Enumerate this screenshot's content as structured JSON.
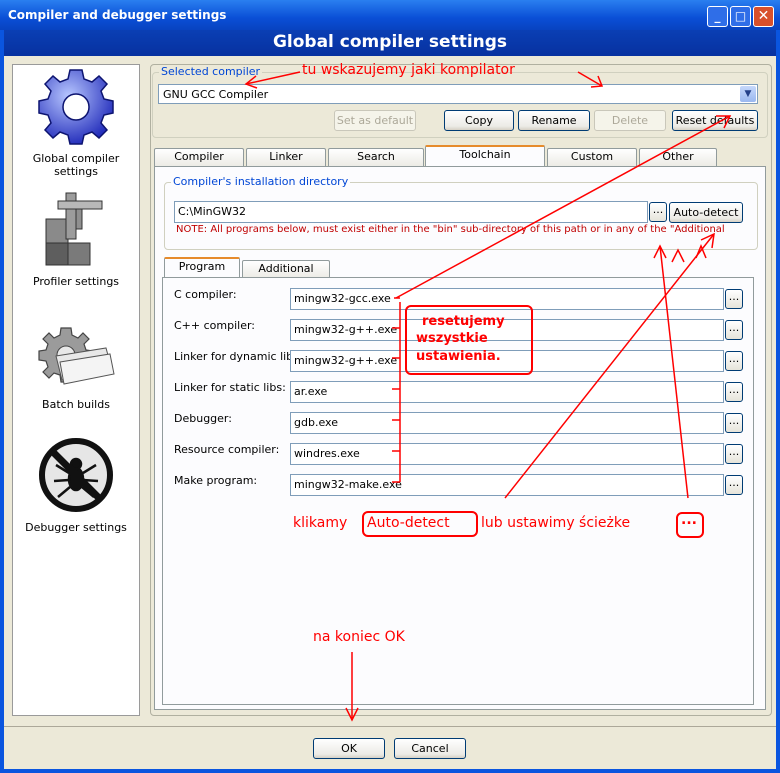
{
  "window": {
    "title": "Compiler and debugger settings"
  },
  "header": {
    "title": "Global compiler settings"
  },
  "sidebar": {
    "items": [
      {
        "label": "Global compiler settings"
      },
      {
        "label": "Profiler settings"
      },
      {
        "label": "Batch builds"
      },
      {
        "label": "Debugger settings"
      }
    ]
  },
  "selected_compiler": {
    "group_label": "Selected compiler",
    "value": "GNU GCC Compiler"
  },
  "compiler_buttons": {
    "set_default": "Set as default",
    "copy": "Copy",
    "rename": "Rename",
    "delete": "Delete",
    "reset_defaults": "Reset defaults"
  },
  "tabs": [
    "Compiler settings",
    "Linker settings",
    "Search directories",
    "Toolchain executables",
    "Custom variables",
    "Other settings"
  ],
  "install_dir": {
    "group_label": "Compiler's installation directory",
    "value": "C:\\MinGW32",
    "browse": "...",
    "auto_detect": "Auto-detect",
    "note": "NOTE: All programs below, must exist either in the \"bin\" sub-directory of this path or in any of the \"Additional"
  },
  "subtabs": [
    "Program Files",
    "Additional Paths"
  ],
  "programs": [
    {
      "label": "C compiler:",
      "value": "mingw32-gcc.exe"
    },
    {
      "label": "C++ compiler:",
      "value": "mingw32-g++.exe"
    },
    {
      "label": "Linker for dynamic libs:",
      "value": "mingw32-g++.exe"
    },
    {
      "label": "Linker for static libs:",
      "value": "ar.exe"
    },
    {
      "label": "Debugger:",
      "value": "gdb.exe"
    },
    {
      "label": "Resource compiler:",
      "value": "windres.exe"
    },
    {
      "label": "Make program:",
      "value": "mingw32-make.exe"
    }
  ],
  "footer": {
    "ok": "OK",
    "cancel": "Cancel"
  },
  "annotations": {
    "compiler_hint": "tu wskazujemy jaki kompilator",
    "reset_hint_1": "resetujemy",
    "reset_hint_2": "wszystkie",
    "reset_hint_3": "ustawienia.",
    "auto_hint_pre": "klikamy",
    "auto_hint_btn": "Auto-detect",
    "auto_hint_mid": "lub ustawimy ścieżke",
    "auto_hint_dots": "...",
    "ok_hint": "na koniec OK"
  },
  "colors": {
    "accent": "#0a55df",
    "annotation": "#ff0000",
    "group_label": "#0046d5",
    "note": "#c00000"
  }
}
